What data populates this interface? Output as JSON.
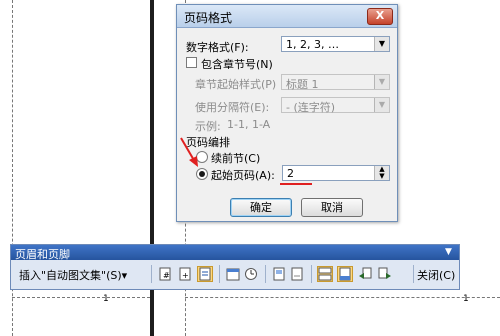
{
  "dialog": {
    "title": "页码格式",
    "close_label": "X",
    "number_format": {
      "label": "数字格式(F):",
      "value": "1, 2, 3, …"
    },
    "include_chapter": {
      "label": "包含章节号(N)",
      "checked": false
    },
    "chapter_style": {
      "label": "章节起始样式(P)",
      "value": "标题 1"
    },
    "separator": {
      "label": "使用分隔符(E):",
      "value": "-  (连字符)"
    },
    "example": {
      "label": "示例:",
      "value": "1-1, 1-A"
    },
    "numbering_section": "页码编排",
    "continue_option": {
      "label": "续前节(C)",
      "selected": false
    },
    "start_at_option": {
      "label": "起始页码(A):",
      "selected": true,
      "value": "2"
    },
    "ok_label": "确定",
    "cancel_label": "取消"
  },
  "toolbar": {
    "title": "页眉和页脚",
    "insert_autotext_label": "插入\"自动图文集\"(S)▾",
    "close_label": "关闭(C)",
    "icons": [
      "insert-page-number-icon",
      "insert-page-count-icon",
      "format-page-number-icon",
      "insert-date-icon",
      "insert-time-icon",
      "page-setup-icon",
      "show-hide-text-icon",
      "link-to-previous-icon",
      "switch-header-footer-icon",
      "show-previous-icon",
      "show-next-icon"
    ]
  },
  "document": {
    "left_page_number": "1",
    "right_page_number": "1"
  },
  "colors": {
    "accent": "#3f74c7",
    "annotation_red": "#e02020"
  }
}
